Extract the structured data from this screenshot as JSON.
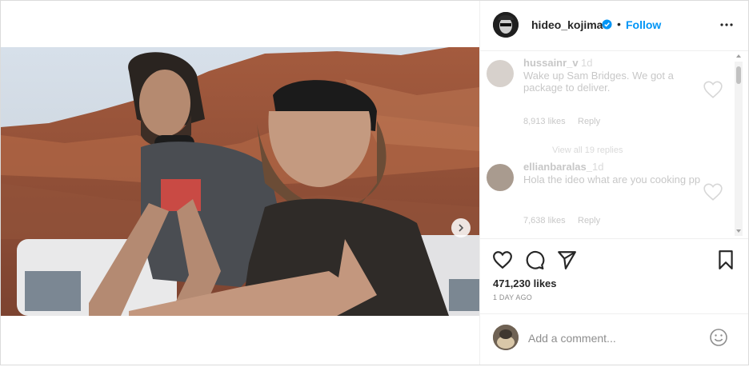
{
  "post": {
    "username": "hideo_kojima",
    "follow_label": "Follow",
    "separator": "•",
    "likes": "471,230 likes",
    "date": "1 DAY AGO",
    "comment_placeholder": "Add a comment...",
    "carousel": {
      "slide_count": 3,
      "active_slide": 1
    }
  },
  "comments": [
    {
      "username": "hussainr_v",
      "age": "1d",
      "text": "Wake up Sam Bridges. We got a package to deliver.",
      "likes": "8,913 likes",
      "reply_label": "Reply",
      "view_replies": "View all 19 replies"
    },
    {
      "username": "ellianbaralas_",
      "age": "1d",
      "text": "Hola the ideo what are you cooking pp",
      "likes": "7,638 likes",
      "reply_label": "Reply"
    }
  ],
  "colors": {
    "accent": "#0095f6",
    "text": "#262626",
    "muted": "#8e8e8e",
    "border": "#dbdbdb"
  },
  "icons": [
    "verified-badge-icon",
    "more-options-icon",
    "heart-icon",
    "comment-icon",
    "share-icon",
    "bookmark-icon",
    "emoji-icon",
    "chevron-right-icon"
  ]
}
